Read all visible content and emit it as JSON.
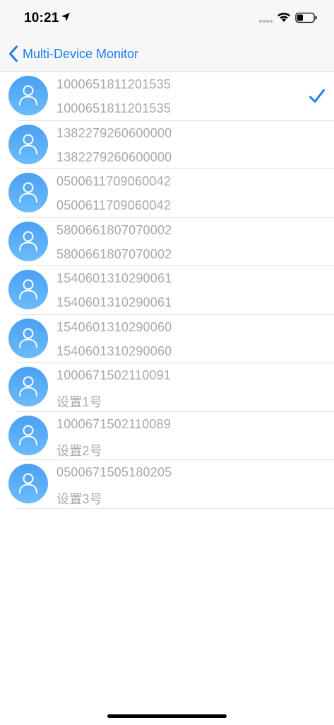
{
  "status_bar": {
    "time": "10:21"
  },
  "nav": {
    "back_label": "Multi-Device Monitor"
  },
  "devices": [
    {
      "id": "1000651811201535",
      "name": "1000651811201535",
      "selected": true
    },
    {
      "id": "1382279260600000",
      "name": "1382279260600000",
      "selected": false
    },
    {
      "id": "0500611709060042",
      "name": "0500611709060042",
      "selected": false
    },
    {
      "id": "5800661807070002",
      "name": "5800661807070002",
      "selected": false
    },
    {
      "id": "1540601310290061",
      "name": "1540601310290061",
      "selected": false
    },
    {
      "id": "1540601310290060",
      "name": "1540601310290060",
      "selected": false
    },
    {
      "id": "1000671502110091",
      "name": " 设置1号",
      "selected": false
    },
    {
      "id": "1000671502110089",
      "name": "设置2号",
      "selected": false
    },
    {
      "id": "0500671505180205",
      "name": "设置3号",
      "selected": false
    }
  ],
  "colors": {
    "accent": "#1c7cf4",
    "text_secondary": "#a9a9a9",
    "avatar": "#5aaef6"
  }
}
